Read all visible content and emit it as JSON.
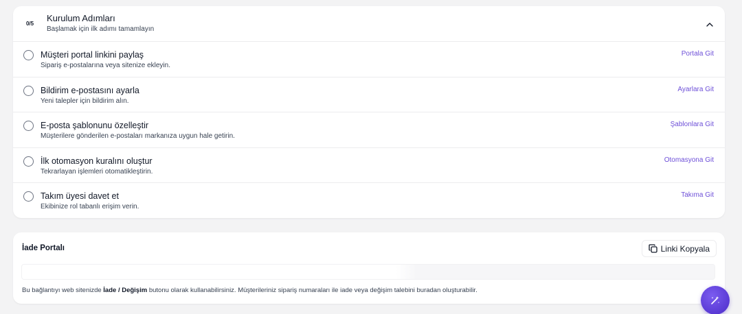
{
  "setup": {
    "progress": "0/5",
    "title": "Kurulum Adımları",
    "subtitle": "Başlamak için ilk adımı tamamlayın",
    "steps": [
      {
        "title": "Müşteri portal linkini paylaş",
        "description": "Sipariş e-postalarına veya sitenize ekleyin.",
        "link": "Portala Git"
      },
      {
        "title": "Bildirim e-postasını ayarla",
        "description": "Yeni talepler için bildirim alın.",
        "link": "Ayarlara Git"
      },
      {
        "title": "E-posta şablonunu özelleştir",
        "description": "Müşterilere gönderilen e-postaları markanıza uygun hale getirin.",
        "link": "Şablonlara Git"
      },
      {
        "title": "İlk otomasyon kuralını oluştur",
        "description": "Tekrarlayan işlemleri otomatikleştirin.",
        "link": "Otomasyona Git"
      },
      {
        "title": "Takım üyesi davet et",
        "description": "Ekibinize rol tabanlı erişim verin.",
        "link": "Takıma Git"
      }
    ]
  },
  "portal": {
    "title": "İade Portalı",
    "copy_label": "Linki Kopyala",
    "link_value": "",
    "note_prefix": "Bu bağlantıyı web sitenizde ",
    "note_bold": "İade / Değişim",
    "note_suffix": " butonu olarak kullanabilirsiniz. Müşterileriniz sipariş numaraları ile iade veya değişim talebini buradan oluşturabilir."
  },
  "colors": {
    "accent": "#6d4fd8",
    "fab": "#5a3ad8",
    "background": "#f3f3f4"
  },
  "icons": {
    "collapse": "chevron-up-icon",
    "copy": "copy-icon",
    "fab": "magic-wand-icon"
  }
}
